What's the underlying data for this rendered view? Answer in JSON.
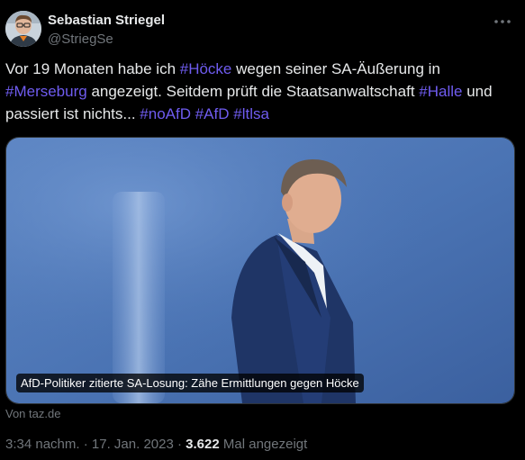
{
  "author": {
    "name": "Sebastian Striegel",
    "handle": "@StriegSe",
    "avatar_icon": "person-portrait-avatar"
  },
  "more_icon": "more-horizontal-icon",
  "tweet": {
    "segments": [
      {
        "text": "Vor 19 Monaten habe ich ",
        "hashtag": false
      },
      {
        "text": "#Höcke",
        "hashtag": true
      },
      {
        "text": " wegen seiner SA-Äußerung in ",
        "hashtag": false
      },
      {
        "text": "#Merseburg",
        "hashtag": true
      },
      {
        "text": " angezeigt. Seitdem prüft die Staatsanwaltschaft ",
        "hashtag": false
      },
      {
        "text": "#Halle",
        "hashtag": true
      },
      {
        "text": " und passiert ist nichts... ",
        "hashtag": false
      },
      {
        "text": "#noAfD",
        "hashtag": true
      },
      {
        "text": " ",
        "hashtag": false
      },
      {
        "text": "#AfD",
        "hashtag": true
      },
      {
        "text": " ",
        "hashtag": false
      },
      {
        "text": "#ltlsa",
        "hashtag": true
      }
    ]
  },
  "card": {
    "caption": "AfD-Politiker zitierte SA-Losung: Zähe Ermittlungen gegen Höcke",
    "source": "Von taz.de",
    "image_description_icon": "man-in-suit-photo"
  },
  "meta": {
    "time": "3:34 nachm.",
    "separator": "·",
    "date": "17. Jan. 2023",
    "views_count": "3.622",
    "views_label": "Mal angezeigt"
  },
  "colors": {
    "background": "#000000",
    "text": "#e7e9ea",
    "muted": "#71767b",
    "hashtag": "#6f5cf0"
  }
}
